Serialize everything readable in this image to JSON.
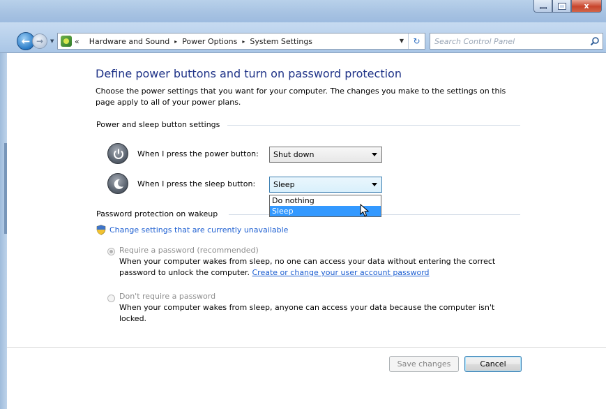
{
  "window": {
    "controls": {
      "minimize_icon": "minimize-icon",
      "maximize_icon": "maximize-icon",
      "close_glyph": "x"
    }
  },
  "navbar": {
    "back_glyph": "←",
    "forward_glyph": "→",
    "breadcrumb_prefix": "«",
    "breadcrumbs": [
      "Hardware and Sound",
      "Power Options",
      "System Settings"
    ],
    "crumb_separator": "▸",
    "refresh_glyph": "↻",
    "search_placeholder": "Search Control Panel"
  },
  "main": {
    "title": "Define power buttons and turn on password protection",
    "description": "Choose the power settings that you want for your computer. The changes you make to the settings on this page apply to all of your power plans.",
    "power_group": {
      "heading": "Power and sleep button settings",
      "power_button_label": "When I press the power button:",
      "power_button_value": "Shut down",
      "sleep_button_label": "When I press the sleep button:",
      "sleep_button_value": "Sleep",
      "sleep_options": [
        "Do nothing",
        "Sleep"
      ],
      "sleep_selected_index": 1
    },
    "password_group": {
      "heading": "Password protection on wakeup",
      "change_link": "Change settings that are currently unavailable",
      "require": {
        "label": "Require a password (recommended)",
        "desc": "When your computer wakes from sleep, no one can access your data without entering the correct password to unlock the computer.",
        "link": "Create or change your user account password",
        "checked": true
      },
      "dont_require": {
        "label": "Don't require a password",
        "desc": "When your computer wakes from sleep, anyone can access your data because the computer isn't locked.",
        "checked": false
      }
    }
  },
  "footer": {
    "save_label": "Save changes",
    "cancel_label": "Cancel"
  },
  "colors": {
    "title": "#1e3287",
    "link": "#1c5ed1",
    "selection": "#3399ff"
  }
}
